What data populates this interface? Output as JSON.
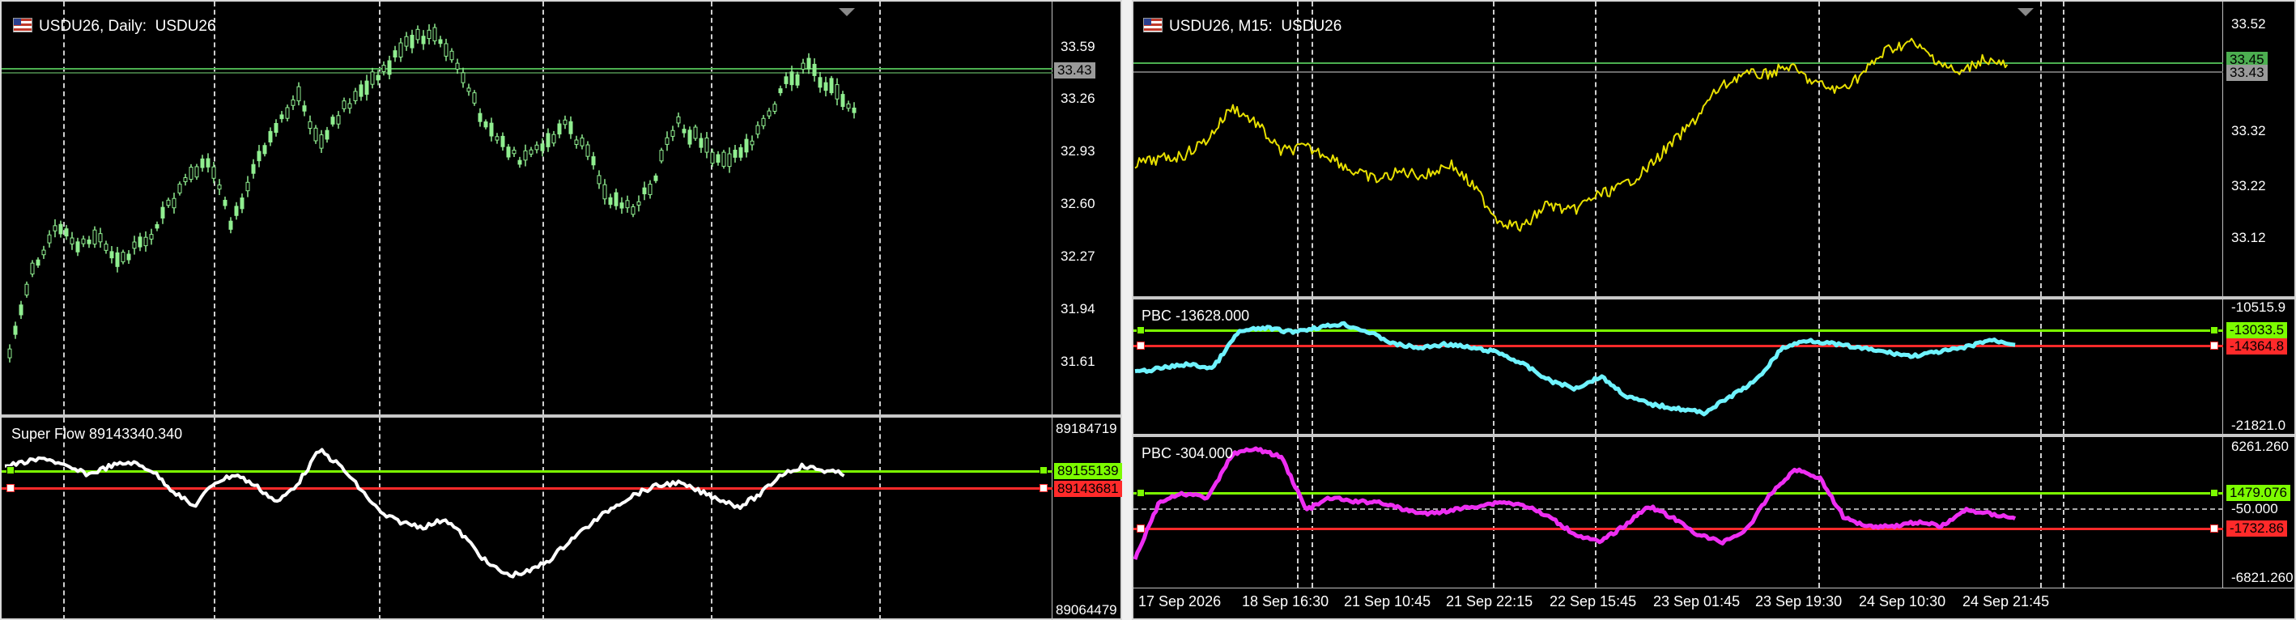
{
  "left_window": {
    "main_title": "USDU26, Daily:  USDU26",
    "main_prices": [
      "33.59",
      "33.43",
      "33.26",
      "32.93",
      "32.60",
      "32.27",
      "31.94",
      "31.61"
    ],
    "main_price_tag": "33.43",
    "indicator_title": "Super Flow 89143340.340",
    "indicator_axis": [
      "89184719",
      "89064479"
    ],
    "indicator_tag_green": "89155139",
    "indicator_tag_red": "89143681",
    "colors": {
      "candles": "#90ee90",
      "line": "#ffffff",
      "green_level": "#7cfc00",
      "red_level": "#ff2a2a"
    }
  },
  "right_window": {
    "main_title": "USDU26, M15:  USDU26",
    "main_prices": [
      "33.52",
      "33.45",
      "33.43",
      "33.32",
      "33.22",
      "33.12"
    ],
    "main_price_tag_green": "33.45",
    "main_price_tag_gray": "33.43",
    "pbc1_title": "PBC -13628.000",
    "pbc1_axis": [
      "-10515.9",
      "-21821.0"
    ],
    "pbc1_tag_green": "-13033.5",
    "pbc1_tag_red": "-14364.8",
    "pbc2_title": "PBC -304.000",
    "pbc2_axis": [
      "6261.260",
      "-6821.260"
    ],
    "pbc2_tag_green": "1479.076",
    "pbc2_tag_red": "-1732.86",
    "pbc2_level": "-50.000",
    "x_labels": [
      "17 Sep 2026",
      "18 Sep 16:30",
      "21 Sep 10:45",
      "21 Sep 22:15",
      "22 Sep 15:45",
      "23 Sep 01:45",
      "23 Sep 19:30",
      "24 Sep 10:30",
      "24 Sep 21:45"
    ],
    "colors": {
      "price_line": "#e8e000",
      "pbc1": "#6ff3ff",
      "pbc2": "#ee2ef2",
      "green_level": "#7cfc00",
      "red_level": "#ff2a2a"
    }
  }
}
